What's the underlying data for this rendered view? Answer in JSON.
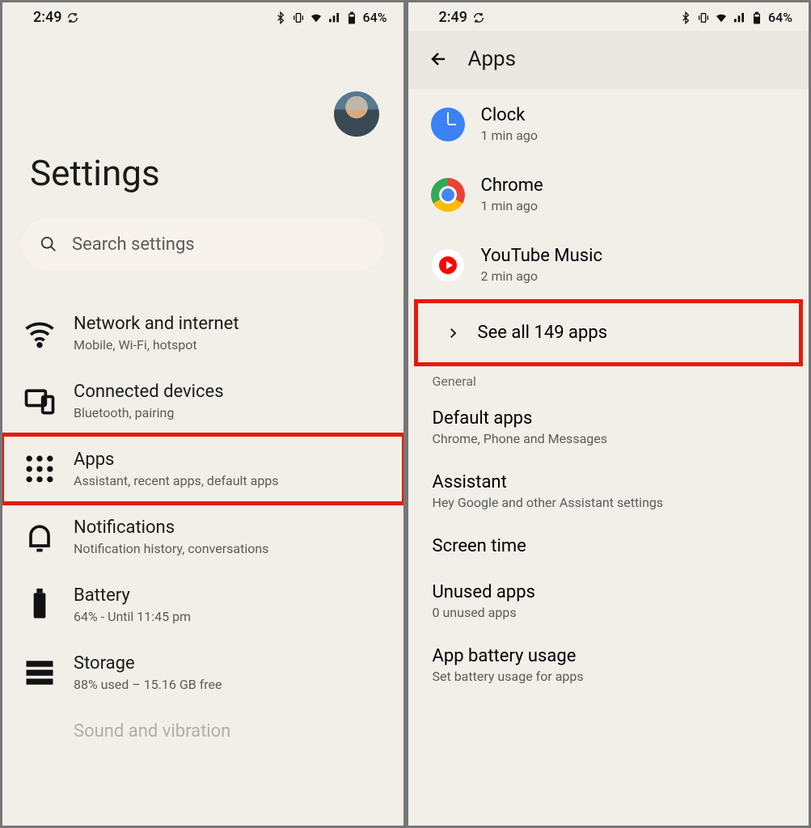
{
  "status": {
    "time": "2:49",
    "battery": "64%"
  },
  "left": {
    "title": "Settings",
    "search_placeholder": "Search settings",
    "items": [
      {
        "label": "Network and internet",
        "sub": "Mobile, Wi-Fi, hotspot"
      },
      {
        "label": "Connected devices",
        "sub": "Bluetooth, pairing"
      },
      {
        "label": "Apps",
        "sub": "Assistant, recent apps, default apps"
      },
      {
        "label": "Notifications",
        "sub": "Notification history, conversations"
      },
      {
        "label": "Battery",
        "sub": "64% - Until 11:45 pm"
      },
      {
        "label": "Storage",
        "sub": "88% used – 15.16 GB free"
      },
      {
        "label": "Sound and vibration",
        "sub": ""
      }
    ]
  },
  "right": {
    "title": "Apps",
    "recent": [
      {
        "label": "Clock",
        "sub": "1 min ago"
      },
      {
        "label": "Chrome",
        "sub": "1 min ago"
      },
      {
        "label": "YouTube Music",
        "sub": "2 min ago"
      }
    ],
    "see_all": "See all 149 apps",
    "section": "General",
    "options": [
      {
        "label": "Default apps",
        "sub": "Chrome, Phone and Messages"
      },
      {
        "label": "Assistant",
        "sub": "Hey Google and other Assistant settings"
      },
      {
        "label": "Screen time",
        "sub": ""
      },
      {
        "label": "Unused apps",
        "sub": "0 unused apps"
      },
      {
        "label": "App battery usage",
        "sub": "Set battery usage for apps"
      }
    ]
  }
}
